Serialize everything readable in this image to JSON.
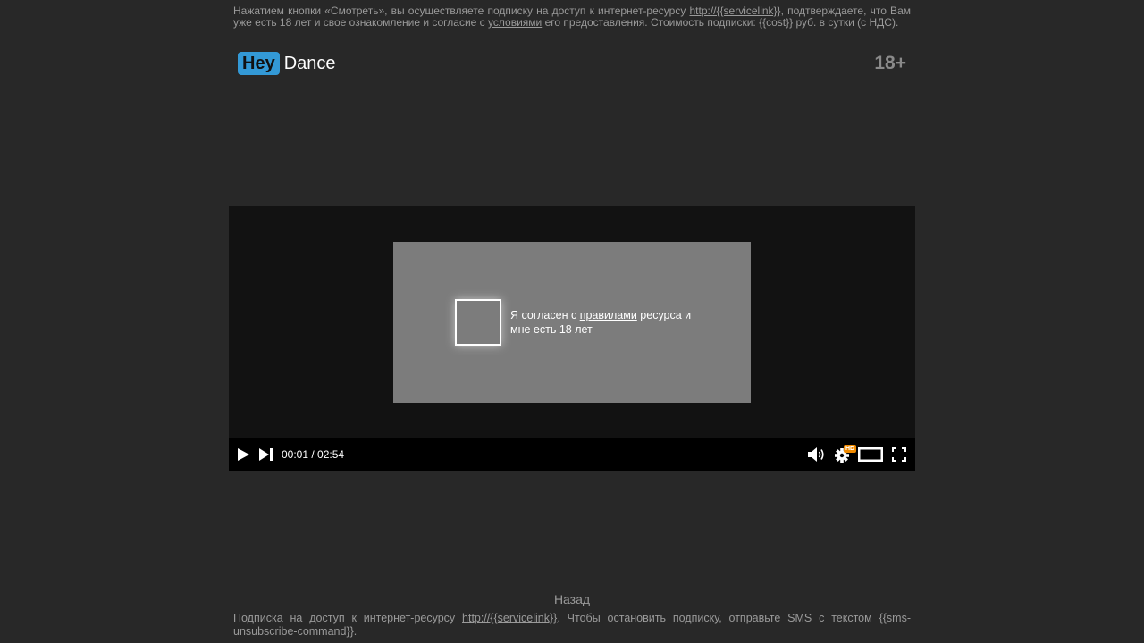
{
  "disclaimer_top": {
    "part1": "Нажатием кнопки «Смотреть», вы осуществляете подписку на доступ к интернет-ресурсу ",
    "link": "http://{{servicelink}}",
    "part2": ", подтверждаете, что Вам уже есть 18 лет и свое ознакомление и согласие с ",
    "terms_link": "условиями",
    "part3": " его предоставления. Стоимость подписки: {{cost}} руб. в сутки (с НДС)."
  },
  "logo": {
    "hey": "Hey",
    "dance": "Dance"
  },
  "age_badge": "18+",
  "consent": {
    "part1": "Я согласен с ",
    "rules_link": "правилами",
    "part2": " ресурса и мне есть 18 лет"
  },
  "player": {
    "time": "00:01 / 02:54",
    "hd_badge": "HD"
  },
  "back_link": "Назад",
  "disclaimer_bottom": {
    "part1": "Подписка на доступ к интернет-ресурсу ",
    "link": "http://{{servicelink}}",
    "part2": ". Чтобы остановить подписку, отправьте SMS с текстом {{sms-unsubscribe-command}}."
  },
  "colors": {
    "background": "#282828",
    "logo_accent": "#3399d6",
    "consent_panel": "#7c7c7c",
    "hd_badge": "#f08a00"
  }
}
